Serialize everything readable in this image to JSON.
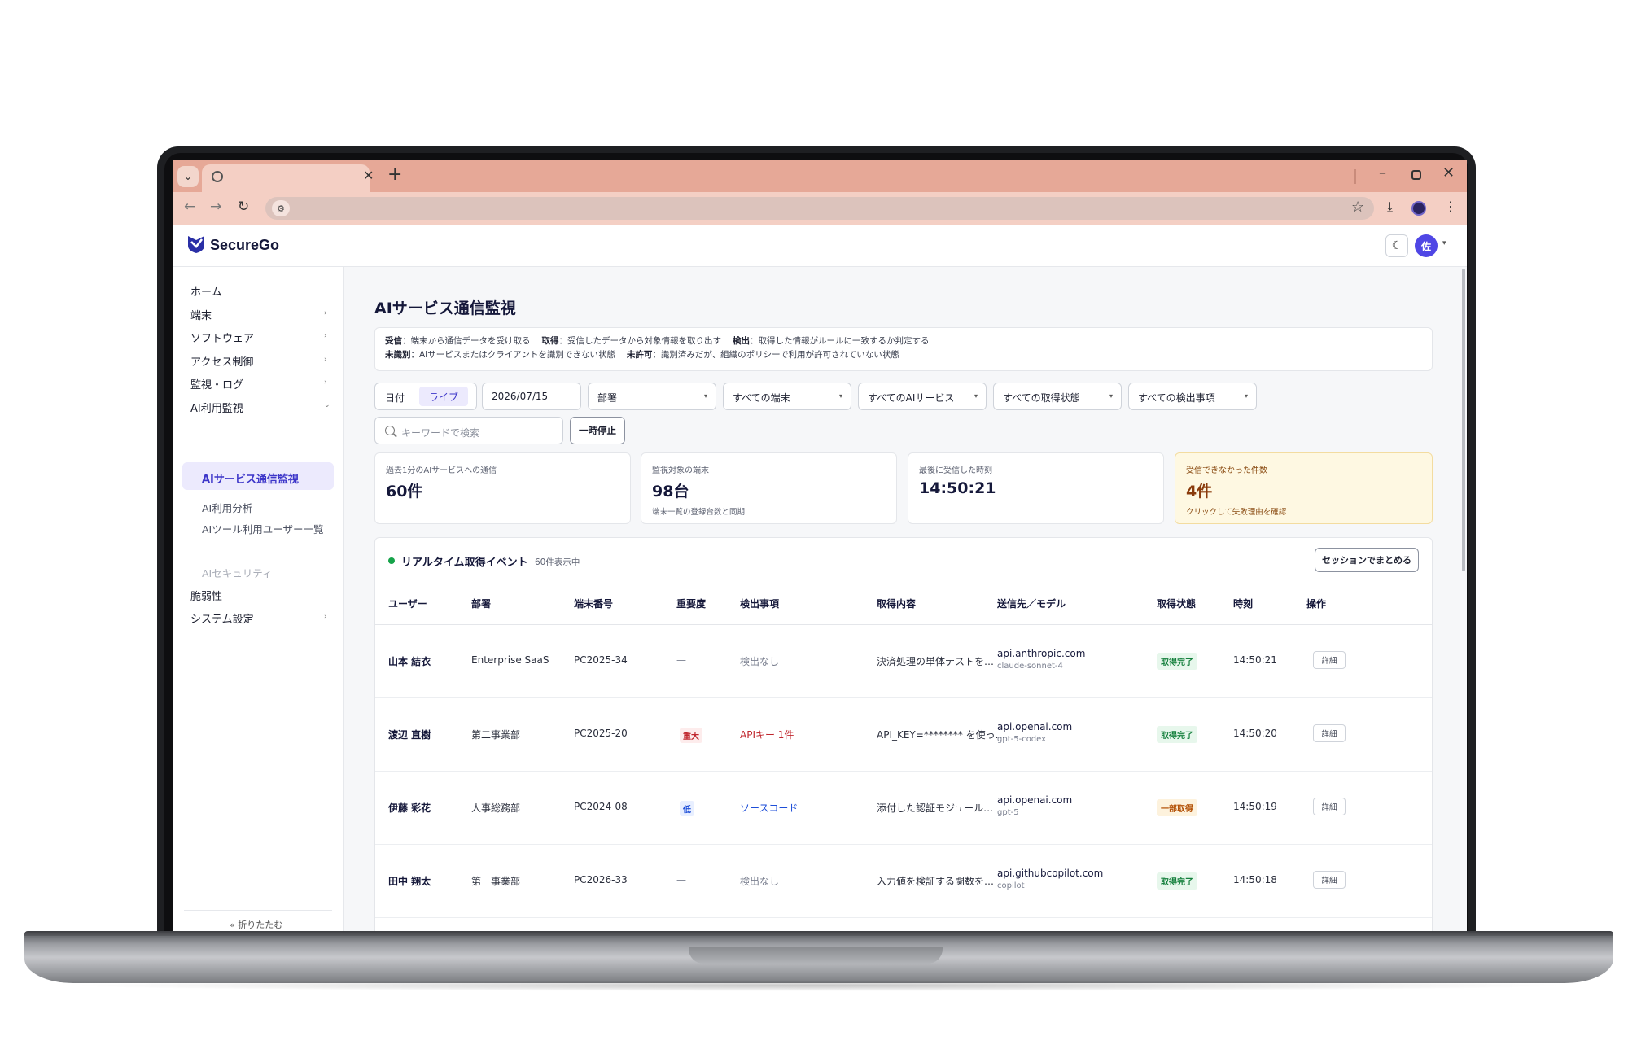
{
  "app": {
    "name": "SecureGo",
    "avatar_initial": "佐"
  },
  "sidebar": {
    "items": [
      {
        "label": "ホーム"
      },
      {
        "label": "端末"
      },
      {
        "label": "ソフトウェア"
      },
      {
        "label": "アクセス制御"
      },
      {
        "label": "監視・ログ"
      },
      {
        "label": "AI利用監視"
      },
      {
        "label": "脆弱性"
      },
      {
        "label": "システム設定"
      }
    ],
    "subitems": [
      {
        "label": "AIサービス通信監視"
      },
      {
        "label": "AI利用分析"
      },
      {
        "label": "AIツール利用ユーザー一覧"
      },
      {
        "label": "AIセキュリティ"
      }
    ],
    "collapse_label": "« 折りたたむ"
  },
  "page": {
    "title": "AIサービス通信監視",
    "legend": {
      "recv_term": "受信",
      "recv_desc": "：端末から通信データを受け取る",
      "acq_term": "取得",
      "acq_desc": "：受信したデータから対象情報を取り出す",
      "det_term": "検出",
      "det_desc": "：取得した情報がルールに一致するか判定する",
      "unid_term": "未識別",
      "unid_desc": "：AIサービスまたはクライアントを識別できない状態",
      "unauth_term": "未許可",
      "unauth_desc": "：識別済みだが、組織のポリシーで利用が許可されていない状態"
    }
  },
  "filters": {
    "date_label": "日付",
    "live_label": "ライブ",
    "date_value": "2026/07/15",
    "department": "部署",
    "devices": "すべての端末",
    "services": "すべてのAIサービス",
    "status": "すべての取得状態",
    "detections": "すべての検出事項",
    "search_placeholder": "キーワードで検索",
    "pause_label": "一時停止"
  },
  "stats": [
    {
      "label": "過去1分のAIサービスへの通信",
      "value": "60件",
      "sub": ""
    },
    {
      "label": "監視対象の端末",
      "value": "98台",
      "sub": "端末一覧の登録台数と同期"
    },
    {
      "label": "最後に受信した時刻",
      "value": "14:50:21",
      "sub": ""
    },
    {
      "label": "受信できなかった件数",
      "value": "4件",
      "sub": "クリックして失敗理由を確認"
    }
  ],
  "events": {
    "title": "リアルタイム取得イベント",
    "count_label": "60件表示中",
    "group_button": "セッションでまとめる",
    "columns": [
      "ユーザー",
      "部署",
      "端末番号",
      "重要度",
      "検出事項",
      "取得内容",
      "送信先／モデル",
      "取得状態",
      "時刻",
      "操作"
    ],
    "rows": [
      {
        "user": "山本 結衣",
        "dept": "Enterprise SaaS",
        "device": "PC2025-34",
        "severity": "—",
        "detection": "検出なし",
        "content": "決済処理の単体テストを…",
        "host": "api.anthropic.com",
        "model": "claude-sonnet-4",
        "status": "取得完了",
        "time": "14:50:21",
        "action": "詳細"
      },
      {
        "user": "渡辺 直樹",
        "dept": "第二事業部",
        "device": "PC2025-20",
        "severity": "重大",
        "detection": "APIキー 1件",
        "content": "API_KEY=******** を使っ…",
        "host": "api.openai.com",
        "model": "gpt-5-codex",
        "status": "取得完了",
        "time": "14:50:20",
        "action": "詳細"
      },
      {
        "user": "伊藤 彩花",
        "dept": "人事総務部",
        "device": "PC2024-08",
        "severity": "低",
        "detection": "ソースコード",
        "content": "添付した認証モジュール…",
        "host": "api.openai.com",
        "model": "gpt-5",
        "status": "一部取得",
        "time": "14:50:19",
        "action": "詳細"
      },
      {
        "user": "田中 翔太",
        "dept": "第一事業部",
        "device": "PC2026-33",
        "severity": "—",
        "detection": "検出なし",
        "content": "入力値を検証する関数を…",
        "host": "api.githubcopilot.com",
        "model": "copilot",
        "status": "取得完了",
        "time": "14:50:18",
        "action": "詳細"
      }
    ]
  },
  "colors": {
    "accent": "#4f46e5",
    "tabbar": "#e6a897",
    "toolbar": "#f4cfc4",
    "warning_bg": "#fef8e2",
    "critical": "#c0262d",
    "success": "#15803d"
  }
}
